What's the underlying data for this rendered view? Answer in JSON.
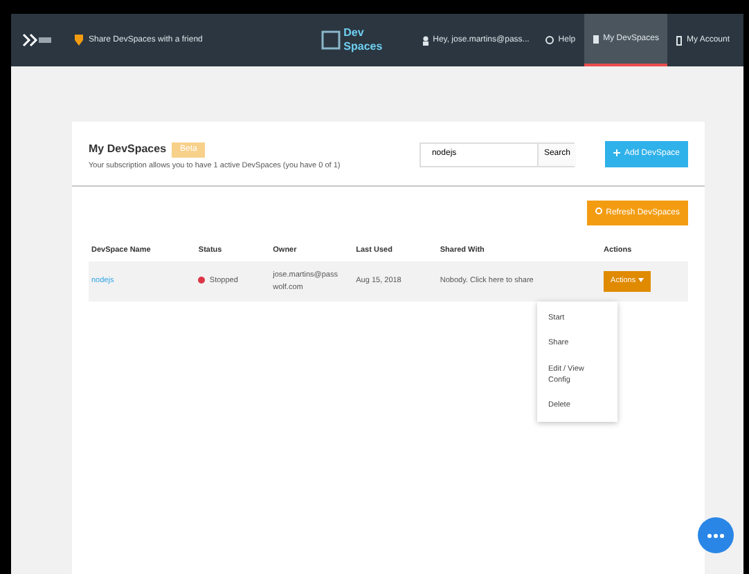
{
  "navbar": {
    "logo": "Dev Spaces",
    "share_link": "Share DevSpaces with a friend",
    "items": [
      {
        "label": "Hey, jose.martins@pass...",
        "kind": "user",
        "selected": false
      },
      {
        "label": "Help",
        "kind": "help",
        "selected": false
      },
      {
        "label": "My DevSpaces",
        "kind": "spaces",
        "selected": true
      },
      {
        "label": "My Account",
        "kind": "account",
        "selected": false
      }
    ]
  },
  "panel": {
    "title": "My DevSpaces",
    "badge": "Beta",
    "subtitle": "Your subscription allows you to have 1 active DevSpaces (you have 0 of 1)",
    "search": {
      "value": "nodejs",
      "button": "Search"
    },
    "add_button": "Add DevSpace",
    "refresh_button": "Refresh DevSpaces",
    "table": {
      "columns": [
        "DevSpace Name",
        "Status",
        "Owner",
        "Last Used",
        "Shared With",
        "Actions"
      ],
      "rows": [
        {
          "name": "nodejs",
          "status": "Stopped",
          "color": "#dc3545",
          "owner": "jose.martins@pass wolf.com",
          "last_used": "Aug 15, 2018",
          "shared_with": "Nobody. Click here to share",
          "action": "Actions",
          "expanded": true
        }
      ]
    },
    "menu": [
      "Start",
      "Share",
      "Edit / View Config",
      "Delete"
    ]
  }
}
